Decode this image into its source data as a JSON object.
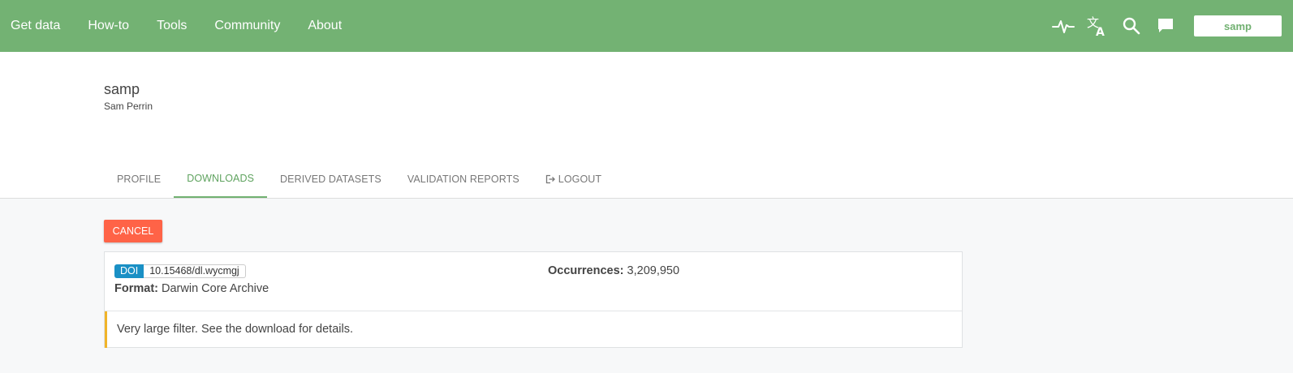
{
  "nav": {
    "items": [
      "Get data",
      "How-to",
      "Tools",
      "Community",
      "About"
    ],
    "icons": [
      "activity-icon",
      "translate-icon",
      "search-icon",
      "feedback-icon"
    ],
    "user_label": "samp"
  },
  "profile": {
    "username": "samp",
    "full_name": "Sam Perrin"
  },
  "tabs": [
    {
      "label": "Profile",
      "active": false
    },
    {
      "label": "Downloads",
      "active": true
    },
    {
      "label": "Derived datasets",
      "active": false
    },
    {
      "label": "Validation reports",
      "active": false
    },
    {
      "label": "Logout",
      "active": false,
      "icon": "logout-icon"
    }
  ],
  "actions": {
    "cancel_label": "Cancel"
  },
  "download": {
    "doi_label": "DOI",
    "doi_value": "10.15468/dl.wycmgj",
    "format_label": "Format:",
    "format_value": "Darwin Core Archive",
    "occurrences_label": "Occurrences:",
    "occurrences_value": "3,209,950",
    "filter_text": "Very large filter. See the download for details."
  },
  "colors": {
    "header_green": "#73b273",
    "accent_green": "#71b171",
    "cancel_red": "#ff6347",
    "doi_blue": "#1a90c5",
    "warning_border": "#f0b429"
  }
}
